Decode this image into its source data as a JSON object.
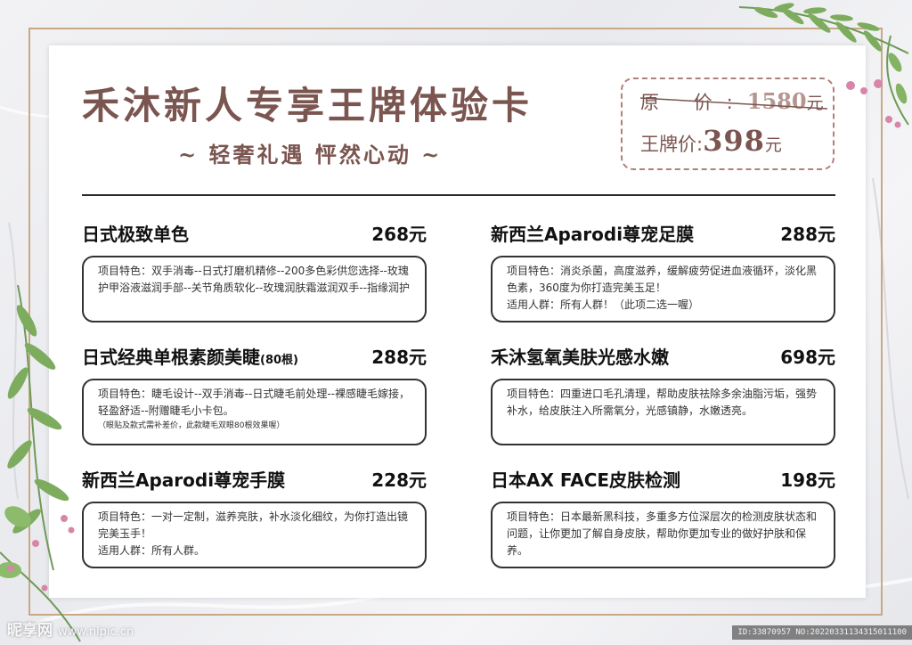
{
  "header": {
    "title": "禾沐新人专享王牌体验卡",
    "subtitle": "~ 轻奢礼遇   怦然心动 ~"
  },
  "price_box": {
    "original_label": "原  价:",
    "original_value": "1580",
    "original_unit": "元",
    "sale_label": "王牌价:",
    "sale_value": "398",
    "sale_unit": "元"
  },
  "services": [
    {
      "name": "日式极致单色",
      "name_suffix": "",
      "price": "268元",
      "lines": [
        "项目特色：双手消毒--日式打磨机精修--200多色彩供您选择--玫瑰护甲浴液滋润手部--关节角质软化--玫瑰润肤霜滋润双手--指缘润护"
      ],
      "note": ""
    },
    {
      "name": "新西兰Aparodi尊宠足膜",
      "name_suffix": "",
      "price": "288元",
      "lines": [
        "项目特色：消炎杀菌，高度滋养，缓解疲劳促进血液循环，淡化黑色素，360度为你打造完美玉足！",
        "适用人群：所有人群！（此项二选一喔）"
      ],
      "note": ""
    },
    {
      "name": "日式经典单根素颜美睫",
      "name_suffix": "(80根)",
      "price": "288元",
      "lines": [
        "项目特色：睫毛设计--双手消毒--日式睫毛前处理--裸感睫毛嫁接，轻盈舒适--附赠睫毛小卡包。"
      ],
      "note": "（眼贴及款式需补差价，此款睫毛双眼80根效果喔）"
    },
    {
      "name": "禾沐氢氧美肤光感水嫩",
      "name_suffix": "",
      "price": "698元",
      "lines": [
        "项目特色：四重进口毛孔清理，帮助皮肤祛除多余油脂污垢，强势补水，给皮肤注入所需氧分，光感镇静，水嫩透亮。"
      ],
      "note": ""
    },
    {
      "name": "新西兰Aparodi尊宠手膜",
      "name_suffix": "",
      "price": "228元",
      "lines": [
        "项目特色：一对一定制，滋养亮肤，补水淡化细纹，为你打造出镜完美玉手！",
        "适用人群：所有人群。"
      ],
      "note": ""
    },
    {
      "name": "日本AX FACE皮肤检测",
      "name_suffix": "",
      "price": "198元",
      "lines": [
        "项目特色：日本最新黑科技，多重多方位深层次的检测皮肤状态和问题，让你更加了解自身皮肤，帮助你更加专业的做好护肤和保养。"
      ],
      "note": ""
    }
  ],
  "watermark": {
    "logo": "昵享网",
    "url": "www.nipic.cn",
    "id_text": "ID:33870957 NO:20220331134315011100"
  },
  "colors": {
    "title": "#7b5550",
    "frame": "#c8a985",
    "price_box_border": "#b0807a",
    "text": "#111111"
  }
}
